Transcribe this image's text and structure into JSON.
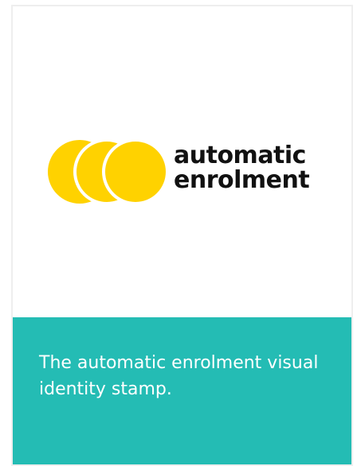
{
  "logo": {
    "line1": "automatic",
    "line2": "enrolment",
    "mark_icon": "three-overlapping-circles-icon",
    "mark_color": "#ffd200",
    "text_color": "#111111"
  },
  "caption": {
    "text": "The automatic enrolment visual identity stamp."
  },
  "colors": {
    "panel": "#24bcb4",
    "card_border": "#eeeeee",
    "background": "#ffffff"
  }
}
